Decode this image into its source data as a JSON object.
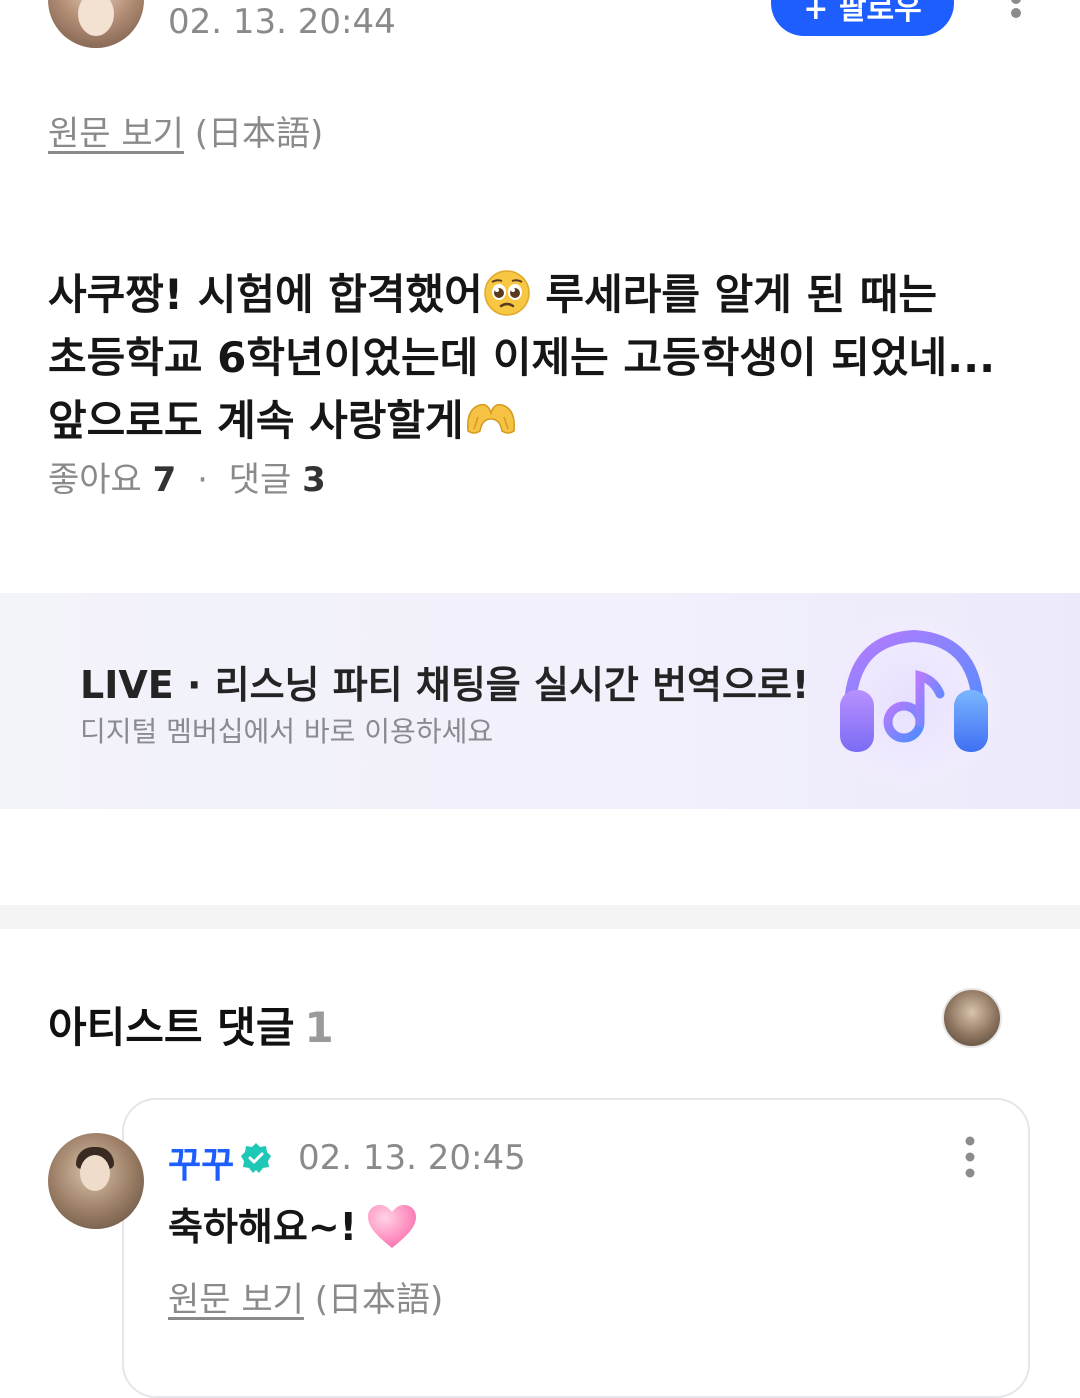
{
  "post": {
    "timestamp": "02. 13. 20:44",
    "follow_label": "+ 팔로우",
    "view_original_link": "원문 보기",
    "view_original_lang": "(日本語)",
    "text_line1a": "사쿠짱! 시험에 합격했어",
    "text_line1b": " 루세라를 알게 된 때는",
    "text_line2": "초등학교 6학년이었는데 이제는 고등학생이 되었네...",
    "text_line3": "앞으로도 계속 사랑할게",
    "emoji1": "pleading-face-emoji",
    "emoji2": "heart-hands-emoji",
    "likes_label": "좋아요",
    "likes_count": "7",
    "comments_label": "댓글",
    "comments_count": "3"
  },
  "banner": {
    "title": "LIVE · 리스닝 파티 채팅을 실시간 번역으로!",
    "subtitle": "디지털 멤버십에서 바로 이용하세요",
    "icon": "headphones-music-icon"
  },
  "artist_comments": {
    "title": "아티스트 댓글",
    "count": "1",
    "comment": {
      "author": "꾸꾸",
      "timestamp": "02. 13. 20:45",
      "text": "축하해요~!",
      "emoji": "pink-heart-emoji",
      "view_original_link": "원문 보기",
      "view_original_lang": "(日本語)"
    }
  },
  "colors": {
    "accent": "#1e5eff",
    "muted": "#8a8a8a",
    "verified": "#1fc7b6"
  }
}
